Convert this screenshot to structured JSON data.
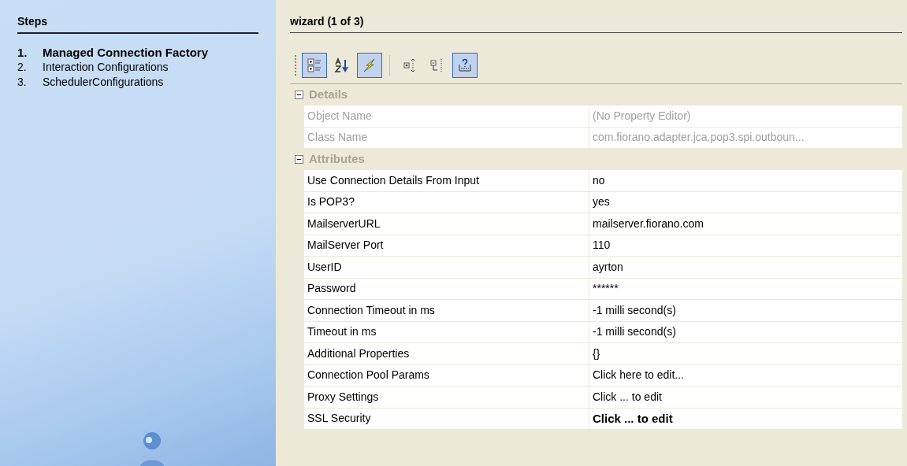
{
  "steps": {
    "title": "Steps",
    "items": [
      {
        "number": "1.",
        "label": "Managed Connection Factory",
        "selected": true
      },
      {
        "number": "2.",
        "label": "Interaction Configurations",
        "selected": false
      },
      {
        "number": "3.",
        "label": "SchedulerConfigurations",
        "selected": false
      }
    ]
  },
  "wizard": {
    "title": "wizard (1 of 3)"
  },
  "toolbar": [
    {
      "kind": "categorized",
      "selected": true
    },
    {
      "kind": "alphabetical",
      "selected": false
    },
    {
      "kind": "events",
      "selected": true
    },
    {
      "kind": "separator",
      "selected": false
    },
    {
      "kind": "expand",
      "selected": false
    },
    {
      "kind": "collapse",
      "selected": false
    },
    {
      "kind": "help",
      "selected": true
    }
  ],
  "groups": [
    {
      "name": "Details",
      "expanded": true,
      "rows": [
        {
          "label": "Object Name",
          "value": "(No Property Editor)",
          "disabled": true,
          "modified": false
        },
        {
          "label": "Class Name",
          "value": "com.fiorano.adapter.jca.pop3.spi.outboun...",
          "disabled": true,
          "modified": false
        }
      ]
    },
    {
      "name": "Attributes",
      "expanded": true,
      "rows": [
        {
          "label": "Use Connection Details From Input",
          "value": "no",
          "disabled": false,
          "modified": false
        },
        {
          "label": "Is POP3?",
          "value": "yes",
          "disabled": false,
          "modified": false
        },
        {
          "label": "MailserverURL",
          "value": "mailserver.fiorano.com",
          "disabled": false,
          "modified": false
        },
        {
          "label": "MailServer Port",
          "value": "110",
          "disabled": false,
          "modified": false
        },
        {
          "label": "UserID",
          "value": "ayrton",
          "disabled": false,
          "modified": false
        },
        {
          "label": "Password",
          "value": "******",
          "disabled": false,
          "modified": false
        },
        {
          "label": "Connection Timeout in ms",
          "value": "-1 milli second(s)",
          "disabled": false,
          "modified": false
        },
        {
          "label": "Timeout in ms",
          "value": "-1 milli second(s)",
          "disabled": false,
          "modified": false
        },
        {
          "label": "Additional Properties",
          "value": "{}",
          "disabled": false,
          "modified": false
        },
        {
          "label": "Connection Pool Params",
          "value": "Click here to edit...",
          "disabled": false,
          "modified": false
        },
        {
          "label": "Proxy Settings",
          "value": "Click ... to edit",
          "disabled": false,
          "modified": false
        },
        {
          "label": "SSL Security",
          "value": "Click ... to edit",
          "disabled": false,
          "modified": true
        }
      ]
    }
  ]
}
